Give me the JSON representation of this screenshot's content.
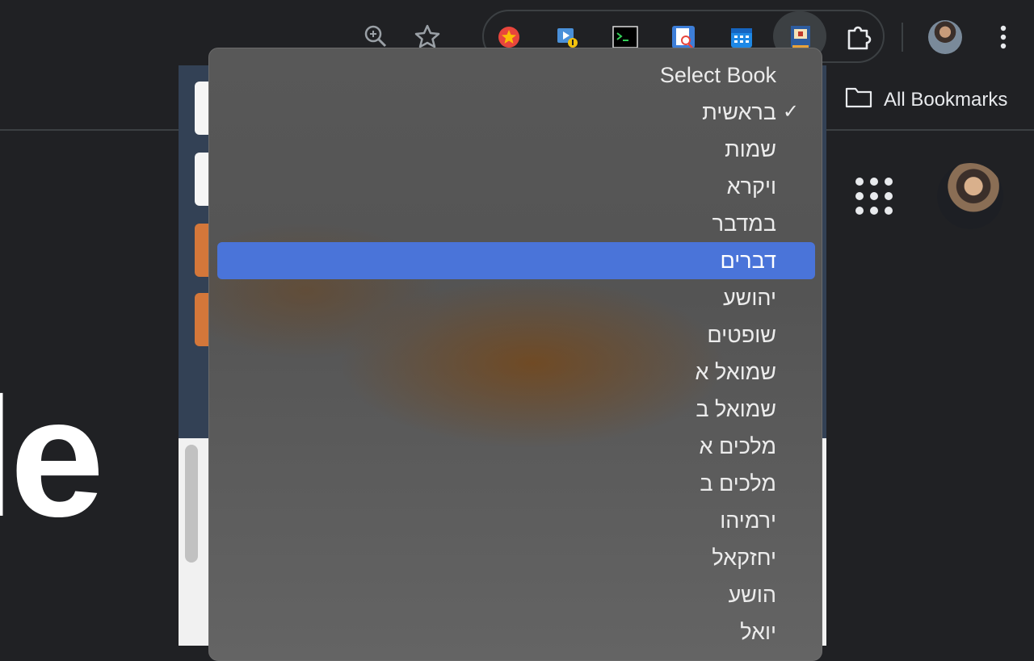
{
  "toolbar": {
    "zoom_icon": "zoom-in-icon",
    "bookmark_star_icon": "star-outline-icon",
    "extensions": [
      {
        "name": "red-star-extension-icon",
        "color": "#e8453c"
      },
      {
        "name": "video-download-extension-icon",
        "color": "#4a90d9"
      },
      {
        "name": "terminal-extension-icon",
        "color": "#000000"
      },
      {
        "name": "document-search-extension-icon",
        "color": "#3d7ed8"
      },
      {
        "name": "calendar-extension-icon",
        "color": "#1e88e5"
      },
      {
        "name": "book-extension-icon",
        "color": "#2d5c9f"
      }
    ],
    "puzzle_icon": "extensions-puzzle-icon",
    "menu_icon": "more-vertical-icon"
  },
  "bookmarks_bar": {
    "folder_label": "All Bookmarks"
  },
  "page": {
    "logo_fragment": "le"
  },
  "dropdown": {
    "header": "Select Book",
    "checked_index": 0,
    "highlighted_index": 4,
    "items": [
      "בראשית",
      "שמות",
      "ויקרא",
      "במדבר",
      "דברים",
      "יהושע",
      "שופטים",
      "שמואל א",
      "שמואל ב",
      "מלכים א",
      "מלכים ב",
      "ירמיהו",
      "יחזקאל",
      "הושע",
      "יואל"
    ],
    "checkmark": "✓"
  },
  "colors": {
    "highlight": "#4a74d9",
    "popup_header": "#334155",
    "accent_button": "#d4773a"
  }
}
